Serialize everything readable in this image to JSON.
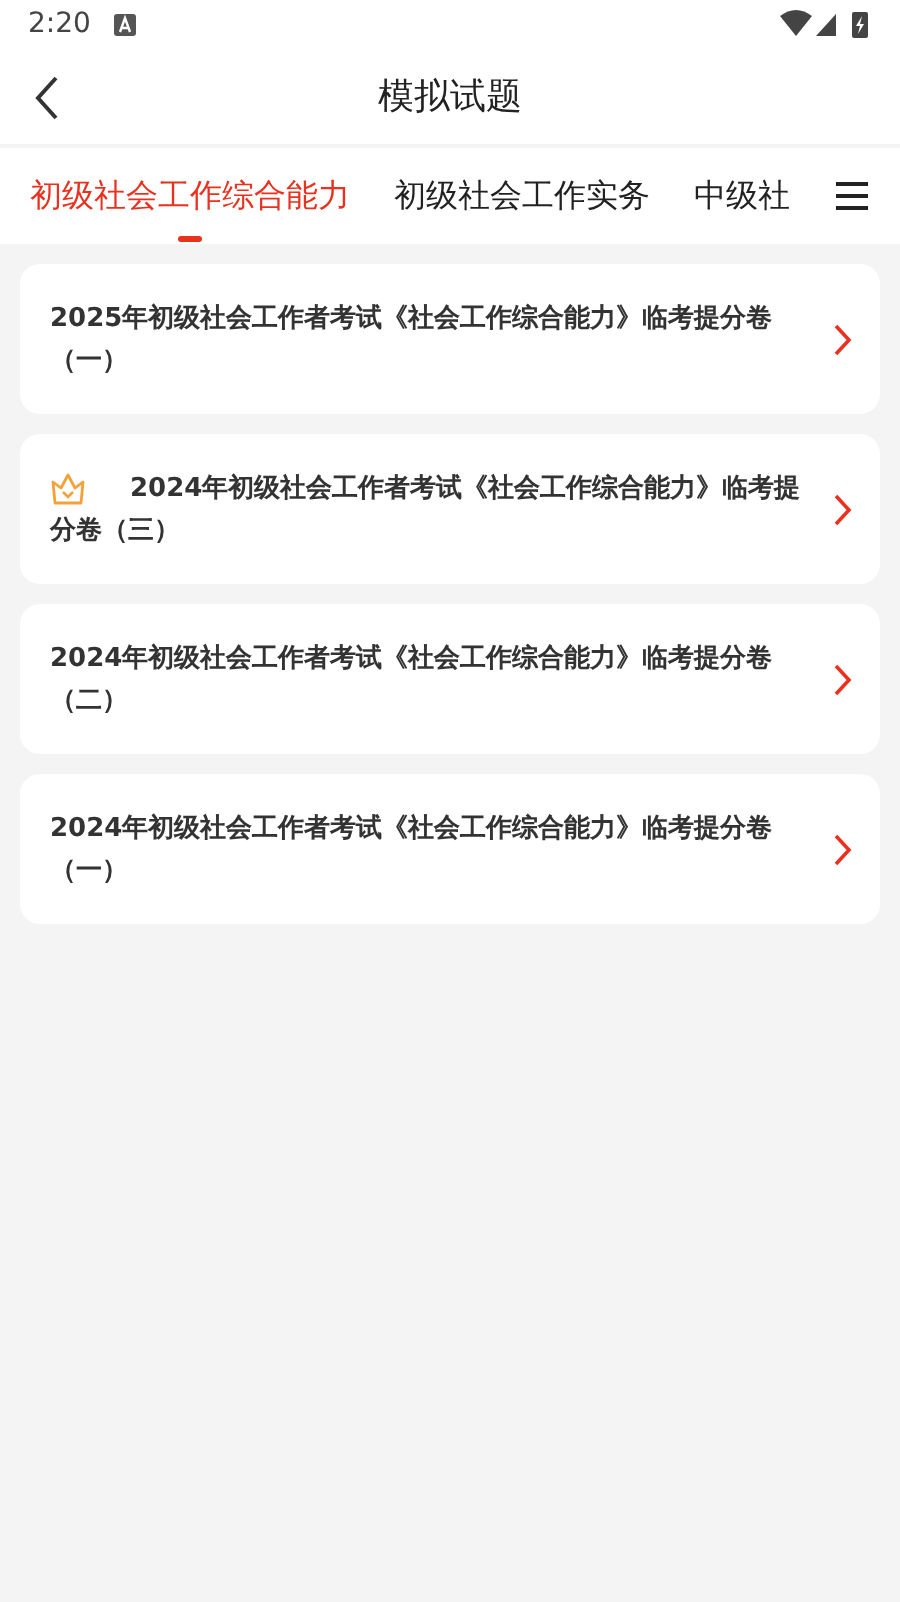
{
  "status_bar": {
    "time": "2:20"
  },
  "header": {
    "title": "模拟试题"
  },
  "tabs": [
    {
      "label": "初级社会工作综合能力",
      "selected": true
    },
    {
      "label": "初级社会工作实务",
      "selected": false
    },
    {
      "label": "中级社",
      "selected": false
    }
  ],
  "papers": [
    {
      "title": "2025年初级社会工作者考试《社会工作综合能力》临考提分卷（一）",
      "premium": false
    },
    {
      "title": "2024年初级社会工作者考试《社会工作综合能力》临考提分卷（三）",
      "premium": true
    },
    {
      "title": "2024年初级社会工作者考试《社会工作综合能力》临考提分卷（二）",
      "premium": false
    },
    {
      "title": "2024年初级社会工作者考试《社会工作综合能力》临考提分卷（一）",
      "premium": false
    }
  ]
}
